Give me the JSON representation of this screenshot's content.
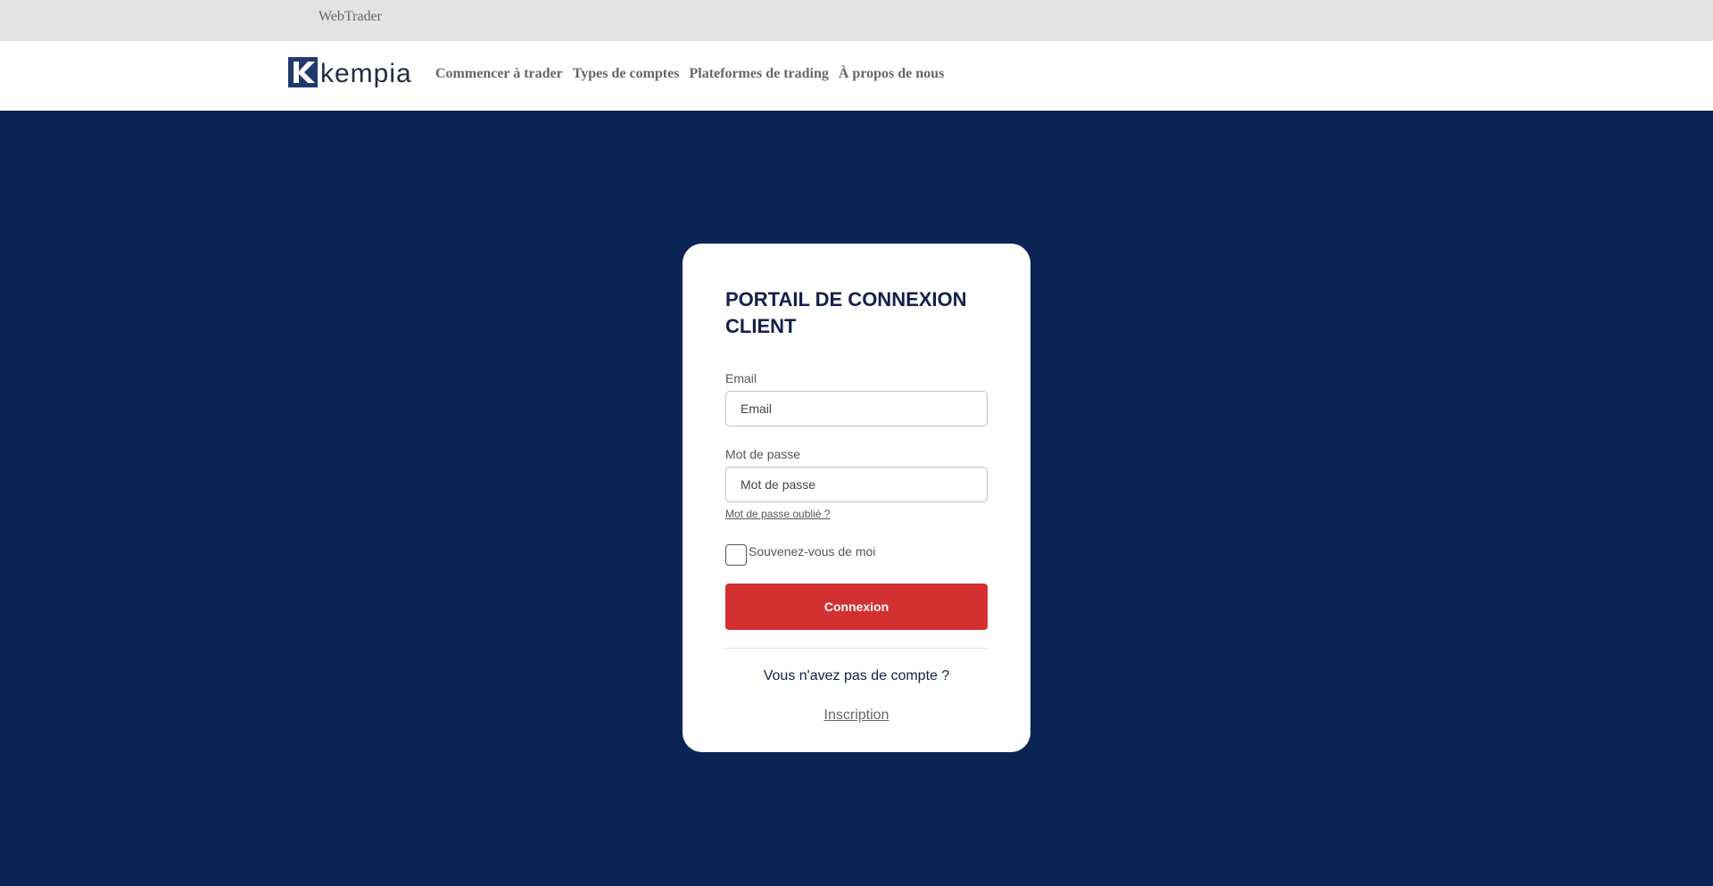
{
  "topbar": {
    "webtrader_label": "WebTrader"
  },
  "brand": {
    "name": "kempia",
    "color": "#1f3a6b"
  },
  "nav": {
    "items": [
      {
        "label": "Commencer à trader"
      },
      {
        "label": "Types de comptes"
      },
      {
        "label": "Plateformes de trading"
      },
      {
        "label": "À propos de nous"
      }
    ]
  },
  "login": {
    "title": "PORTAIL DE CONNEXION CLIENT",
    "email_label": "Email",
    "email_placeholder": "Email",
    "password_label": "Mot de passe",
    "password_placeholder": "Mot de passe",
    "forgot_password": "Mot de passe oublié ?",
    "remember_me": "Souvenez-vous de moi",
    "submit_label": "Connexion",
    "no_account": "Vous n'avez pas de compte ?",
    "signup_label": "Inscription"
  },
  "colors": {
    "background": "#0b2455",
    "button": "#d43030",
    "title": "#13204a"
  }
}
